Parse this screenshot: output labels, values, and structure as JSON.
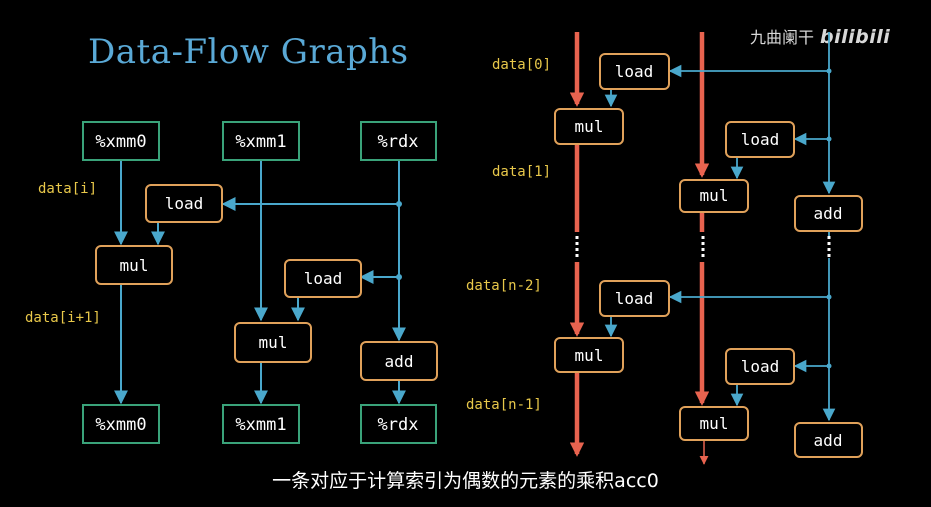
{
  "title": "Data-Flow Graphs",
  "watermark": {
    "channel": "九曲阑干",
    "brand": "bilibili"
  },
  "subtitle": "一条对应于计算索引为偶数的元素的乘积acc0",
  "colors": {
    "register": "#3aa37a",
    "operation": "#e0a15a",
    "flow_line": "#4aa8cc",
    "critical_path": "#e8634f",
    "data_label": "#e8c84a",
    "title": "#5aa9d6"
  },
  "left_graph": {
    "inputs": [
      "%xmm0",
      "%xmm1",
      "%rdx"
    ],
    "outputs": [
      "%xmm0",
      "%xmm1",
      "%rdx"
    ],
    "ops": {
      "load_a": "load",
      "load_b": "load",
      "mul_a": "mul",
      "mul_b": "mul",
      "add": "add"
    },
    "data_labels": [
      "data[i]",
      "data[i+1]"
    ]
  },
  "right_graph": {
    "ops": {
      "load_1": "load",
      "load_2": "load",
      "load_3": "load",
      "load_4": "load",
      "mul_1": "mul",
      "mul_2": "mul",
      "mul_3": "mul",
      "mul_4": "mul",
      "add_1": "add",
      "add_2": "add"
    },
    "data_labels": [
      "data[0]",
      "data[1]",
      "data[n-2]",
      "data[n-1]"
    ]
  }
}
